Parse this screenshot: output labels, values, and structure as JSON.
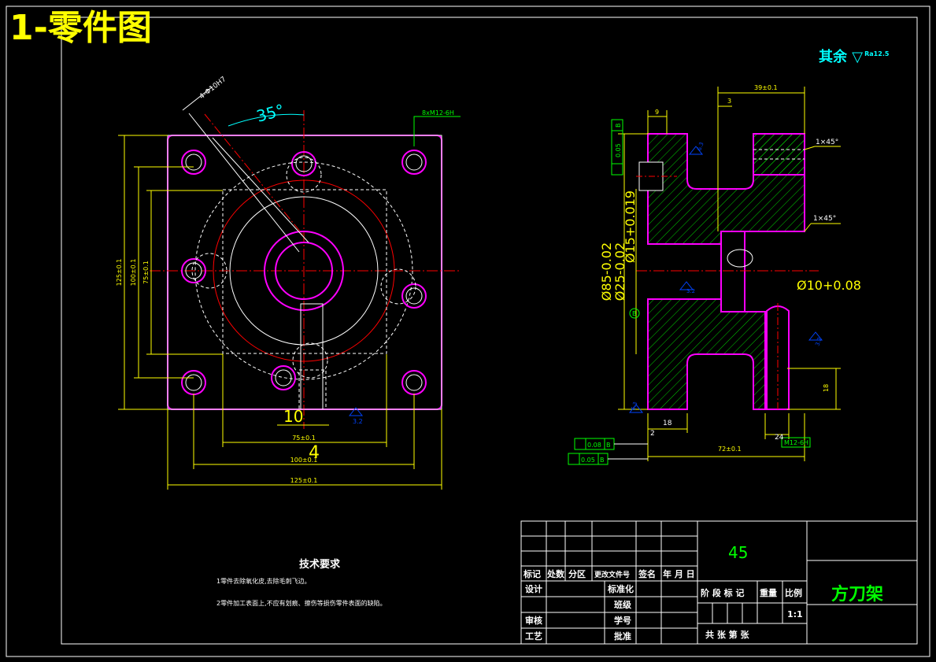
{
  "header": {
    "title": "1-零件图",
    "rest_roughness": "其余",
    "rest_roughness_value": "Ra12.5"
  },
  "dimensions": {
    "front": {
      "angle": "35°",
      "hole_callout": "4-Φ10H7",
      "thread_callout": "8xM12-6H",
      "h_125": "125±0.1",
      "h_100": "100±0.1",
      "h_75": "75±0.1",
      "w_75": "75±0.1",
      "w_100": "100±0.1",
      "w_125": "125±0.1",
      "slot_10": "10",
      "slot_4": "4",
      "rough_face": "3.2"
    },
    "section": {
      "top_39": "39±0.1",
      "top_9": "9",
      "top_3": "3",
      "chamfer_1": "1×45°",
      "chamfer_2": "1×45°",
      "dia_85": "Ø85-0.02",
      "dia_25": "Ø25-0.02",
      "dia_15": "Ø15+0.019",
      "dia_10": "Ø10+0.08",
      "dim_18a": "18",
      "dim_18b": "18",
      "dim_2": "2",
      "dim_24": "24",
      "dim_72": "72±0.1",
      "thread": "M12-6H",
      "tol_flat": "0.08",
      "tol_perp": "0.05",
      "tol_circ": "0.05",
      "datum": "B",
      "rough_1": "6.3",
      "rough_2": "3.2",
      "rough_3": "3.2",
      "rough_4": "6.3"
    }
  },
  "tech_requirements": {
    "title": "技术要求",
    "items": [
      "1零件去除氧化皮,去除毛刺飞边。",
      "2零件加工表面上,不应有划痕、擦伤等损伤零件表面的缺陷。"
    ]
  },
  "title_block": {
    "material": "45",
    "part_name": "方刀架",
    "row_mark": [
      "标记",
      "处数",
      "分区",
      "更改文件号",
      "签名",
      "年 月 日"
    ],
    "design": "设计",
    "review": "审核",
    "process": "工艺",
    "standard": "标准化",
    "class": "班级",
    "student_no": "学号",
    "approve": "批准",
    "stage_header": [
      "阶 段 标 记",
      "重量",
      "比例"
    ],
    "scale": "1:1",
    "sheets": "共    张  第    张"
  }
}
